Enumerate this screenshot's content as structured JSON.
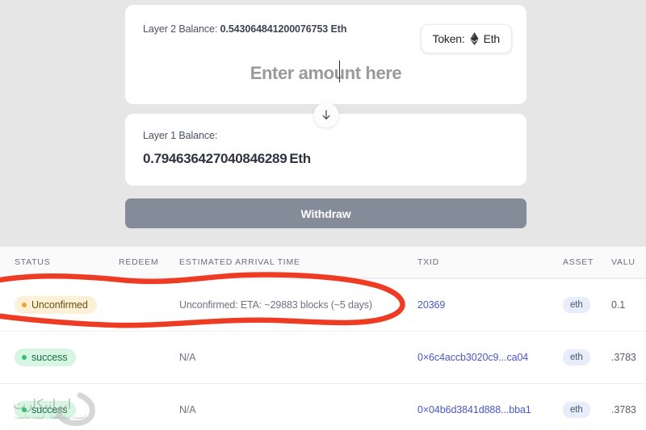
{
  "bridge": {
    "layer2": {
      "label": "Layer 2 Balance:",
      "amount": "0.543064841200076753 Eth"
    },
    "token_selector": {
      "label": "Token:",
      "value": "Eth",
      "icon": "ethereum-diamond-icon"
    },
    "amount_input": {
      "placeholder": "Enter amount here",
      "value": ""
    },
    "swap_direction_icon": "arrow-down-icon",
    "layer1": {
      "label": "Layer 1 Balance:",
      "amount": "0.794636427040846289",
      "unit": "Eth"
    },
    "withdraw_label": "Withdraw"
  },
  "table": {
    "columns": [
      "STATUS",
      "REDEEM",
      "ESTIMATED ARRIVAL TIME",
      "TXID",
      "ASSET",
      "VALU"
    ],
    "rows": [
      {
        "status": "Unconfirmed",
        "status_kind": "unconfirmed",
        "redeem": "",
        "eta": "Unconfirmed: ETA: ~29883 blocks (~5 days)",
        "txid": "20369",
        "asset": "eth",
        "value": "0.1"
      },
      {
        "status": "success",
        "status_kind": "success",
        "redeem": "",
        "eta": "N/A",
        "txid": "0×6c4accb3020c9...ca04",
        "asset": "eth",
        "value": ".3783"
      },
      {
        "status": "success",
        "status_kind": "success",
        "redeem": "",
        "eta": "N/A",
        "txid": "0×04b6d3841d888...bba1",
        "asset": "eth",
        "value": ".3783"
      }
    ]
  },
  "annotation": {
    "shape": "hand-drawn-red-ellipse",
    "color": "#ee3b23"
  },
  "watermark": {
    "text": "ایرانیکارت",
    "subtext": "امنیت پول شما ، امنیت ماست"
  },
  "colors": {
    "page_background": "#e6e6e6",
    "card_background": "#ffffff",
    "withdraw_button": "#858c99",
    "link": "#4b57c4",
    "badge_warning_bg": "#fcf1d7",
    "badge_success_bg": "#d7f5e3",
    "asset_pill_bg": "#e8edfb",
    "annotation_red": "#ee3b23"
  }
}
